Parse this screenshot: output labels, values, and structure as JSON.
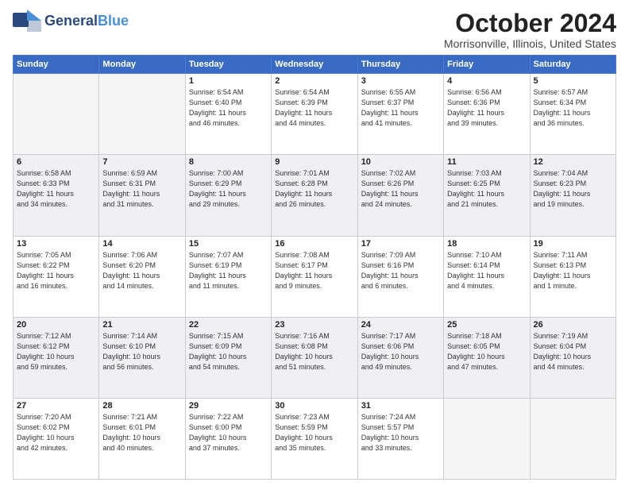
{
  "header": {
    "logo_general": "General",
    "logo_blue": "Blue",
    "month": "October 2024",
    "location": "Morrisonville, Illinois, United States"
  },
  "days_of_week": [
    "Sunday",
    "Monday",
    "Tuesday",
    "Wednesday",
    "Thursday",
    "Friday",
    "Saturday"
  ],
  "weeks": [
    [
      {
        "day": "",
        "info": ""
      },
      {
        "day": "",
        "info": ""
      },
      {
        "day": "1",
        "info": "Sunrise: 6:54 AM\nSunset: 6:40 PM\nDaylight: 11 hours\nand 46 minutes."
      },
      {
        "day": "2",
        "info": "Sunrise: 6:54 AM\nSunset: 6:39 PM\nDaylight: 11 hours\nand 44 minutes."
      },
      {
        "day": "3",
        "info": "Sunrise: 6:55 AM\nSunset: 6:37 PM\nDaylight: 11 hours\nand 41 minutes."
      },
      {
        "day": "4",
        "info": "Sunrise: 6:56 AM\nSunset: 6:36 PM\nDaylight: 11 hours\nand 39 minutes."
      },
      {
        "day": "5",
        "info": "Sunrise: 6:57 AM\nSunset: 6:34 PM\nDaylight: 11 hours\nand 36 minutes."
      }
    ],
    [
      {
        "day": "6",
        "info": "Sunrise: 6:58 AM\nSunset: 6:33 PM\nDaylight: 11 hours\nand 34 minutes."
      },
      {
        "day": "7",
        "info": "Sunrise: 6:59 AM\nSunset: 6:31 PM\nDaylight: 11 hours\nand 31 minutes."
      },
      {
        "day": "8",
        "info": "Sunrise: 7:00 AM\nSunset: 6:29 PM\nDaylight: 11 hours\nand 29 minutes."
      },
      {
        "day": "9",
        "info": "Sunrise: 7:01 AM\nSunset: 6:28 PM\nDaylight: 11 hours\nand 26 minutes."
      },
      {
        "day": "10",
        "info": "Sunrise: 7:02 AM\nSunset: 6:26 PM\nDaylight: 11 hours\nand 24 minutes."
      },
      {
        "day": "11",
        "info": "Sunrise: 7:03 AM\nSunset: 6:25 PM\nDaylight: 11 hours\nand 21 minutes."
      },
      {
        "day": "12",
        "info": "Sunrise: 7:04 AM\nSunset: 6:23 PM\nDaylight: 11 hours\nand 19 minutes."
      }
    ],
    [
      {
        "day": "13",
        "info": "Sunrise: 7:05 AM\nSunset: 6:22 PM\nDaylight: 11 hours\nand 16 minutes."
      },
      {
        "day": "14",
        "info": "Sunrise: 7:06 AM\nSunset: 6:20 PM\nDaylight: 11 hours\nand 14 minutes."
      },
      {
        "day": "15",
        "info": "Sunrise: 7:07 AM\nSunset: 6:19 PM\nDaylight: 11 hours\nand 11 minutes."
      },
      {
        "day": "16",
        "info": "Sunrise: 7:08 AM\nSunset: 6:17 PM\nDaylight: 11 hours\nand 9 minutes."
      },
      {
        "day": "17",
        "info": "Sunrise: 7:09 AM\nSunset: 6:16 PM\nDaylight: 11 hours\nand 6 minutes."
      },
      {
        "day": "18",
        "info": "Sunrise: 7:10 AM\nSunset: 6:14 PM\nDaylight: 11 hours\nand 4 minutes."
      },
      {
        "day": "19",
        "info": "Sunrise: 7:11 AM\nSunset: 6:13 PM\nDaylight: 11 hours\nand 1 minute."
      }
    ],
    [
      {
        "day": "20",
        "info": "Sunrise: 7:12 AM\nSunset: 6:12 PM\nDaylight: 10 hours\nand 59 minutes."
      },
      {
        "day": "21",
        "info": "Sunrise: 7:14 AM\nSunset: 6:10 PM\nDaylight: 10 hours\nand 56 minutes."
      },
      {
        "day": "22",
        "info": "Sunrise: 7:15 AM\nSunset: 6:09 PM\nDaylight: 10 hours\nand 54 minutes."
      },
      {
        "day": "23",
        "info": "Sunrise: 7:16 AM\nSunset: 6:08 PM\nDaylight: 10 hours\nand 51 minutes."
      },
      {
        "day": "24",
        "info": "Sunrise: 7:17 AM\nSunset: 6:06 PM\nDaylight: 10 hours\nand 49 minutes."
      },
      {
        "day": "25",
        "info": "Sunrise: 7:18 AM\nSunset: 6:05 PM\nDaylight: 10 hours\nand 47 minutes."
      },
      {
        "day": "26",
        "info": "Sunrise: 7:19 AM\nSunset: 6:04 PM\nDaylight: 10 hours\nand 44 minutes."
      }
    ],
    [
      {
        "day": "27",
        "info": "Sunrise: 7:20 AM\nSunset: 6:02 PM\nDaylight: 10 hours\nand 42 minutes."
      },
      {
        "day": "28",
        "info": "Sunrise: 7:21 AM\nSunset: 6:01 PM\nDaylight: 10 hours\nand 40 minutes."
      },
      {
        "day": "29",
        "info": "Sunrise: 7:22 AM\nSunset: 6:00 PM\nDaylight: 10 hours\nand 37 minutes."
      },
      {
        "day": "30",
        "info": "Sunrise: 7:23 AM\nSunset: 5:59 PM\nDaylight: 10 hours\nand 35 minutes."
      },
      {
        "day": "31",
        "info": "Sunrise: 7:24 AM\nSunset: 5:57 PM\nDaylight: 10 hours\nand 33 minutes."
      },
      {
        "day": "",
        "info": ""
      },
      {
        "day": "",
        "info": ""
      }
    ]
  ]
}
